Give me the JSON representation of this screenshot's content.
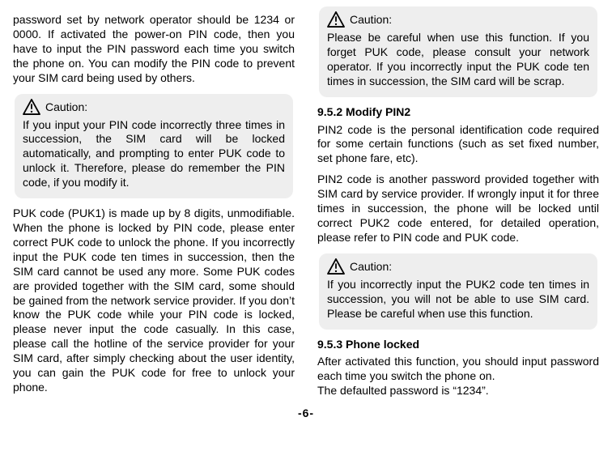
{
  "left": {
    "intro": "password set by network operator should be 1234 or 0000. If activated the power-on PIN code, then you have to input the PIN password each time you switch the phone on. You can modify the PIN code to prevent your SIM card being used by others.",
    "caution1_label": "Caution:",
    "caution1_body": "If you input your PIN code incorrectly three times in succession, the SIM card will be locked automatically, and prompting to enter PUK code to unlock it. Therefore, please do remember the PIN code, if you modify it.",
    "puk_para": "PUK code (PUK1) is made up by 8 digits, unmodifiable. When the phone is locked by PIN code, please enter correct PUK code to unlock the phone. If you incorrectly input the PUK code ten times in succession, then the SIM card cannot be used any more. Some PUK codes are provided together with the SIM card, some should be gained from the network service provider. If you don’t know the PUK code while your PIN code is locked, please never input the code casually. In this case, please call the hotline of the service provider for your SIM card, after simply checking about the user identity, you can gain the PUK code for free to unlock your phone."
  },
  "right": {
    "caution2_label": "Caution:",
    "caution2_body": "Please be careful when use this function. If you forget PUK code, please consult your network operator. If you incorrectly input the PUK code ten times in succession, the SIM card will be scrap.",
    "h1": "9.5.2 Modify PIN2",
    "pin2_p1": "PIN2 code is the personal identification code required for some certain functions (such as set fixed number, set phone fare, etc).",
    "pin2_p2": "PIN2 code is another password provided together with SIM card by service provider. If wrongly input it for three times in succession, the phone will be locked until correct PUK2 code entered, for detailed operation, please refer to PIN code and PUK code.",
    "caution3_label": "Caution:",
    "caution3_body": "If you incorrectly input the PUK2 code ten times in succession, you will not be able to use SIM card. Please be careful when use this function.",
    "h2": "9.5.3 Phone locked",
    "phone_p1": "After activated this function, you should input password each time you switch the phone on.",
    "phone_p2": "The defaulted password is “1234”."
  },
  "footer": "-6-"
}
